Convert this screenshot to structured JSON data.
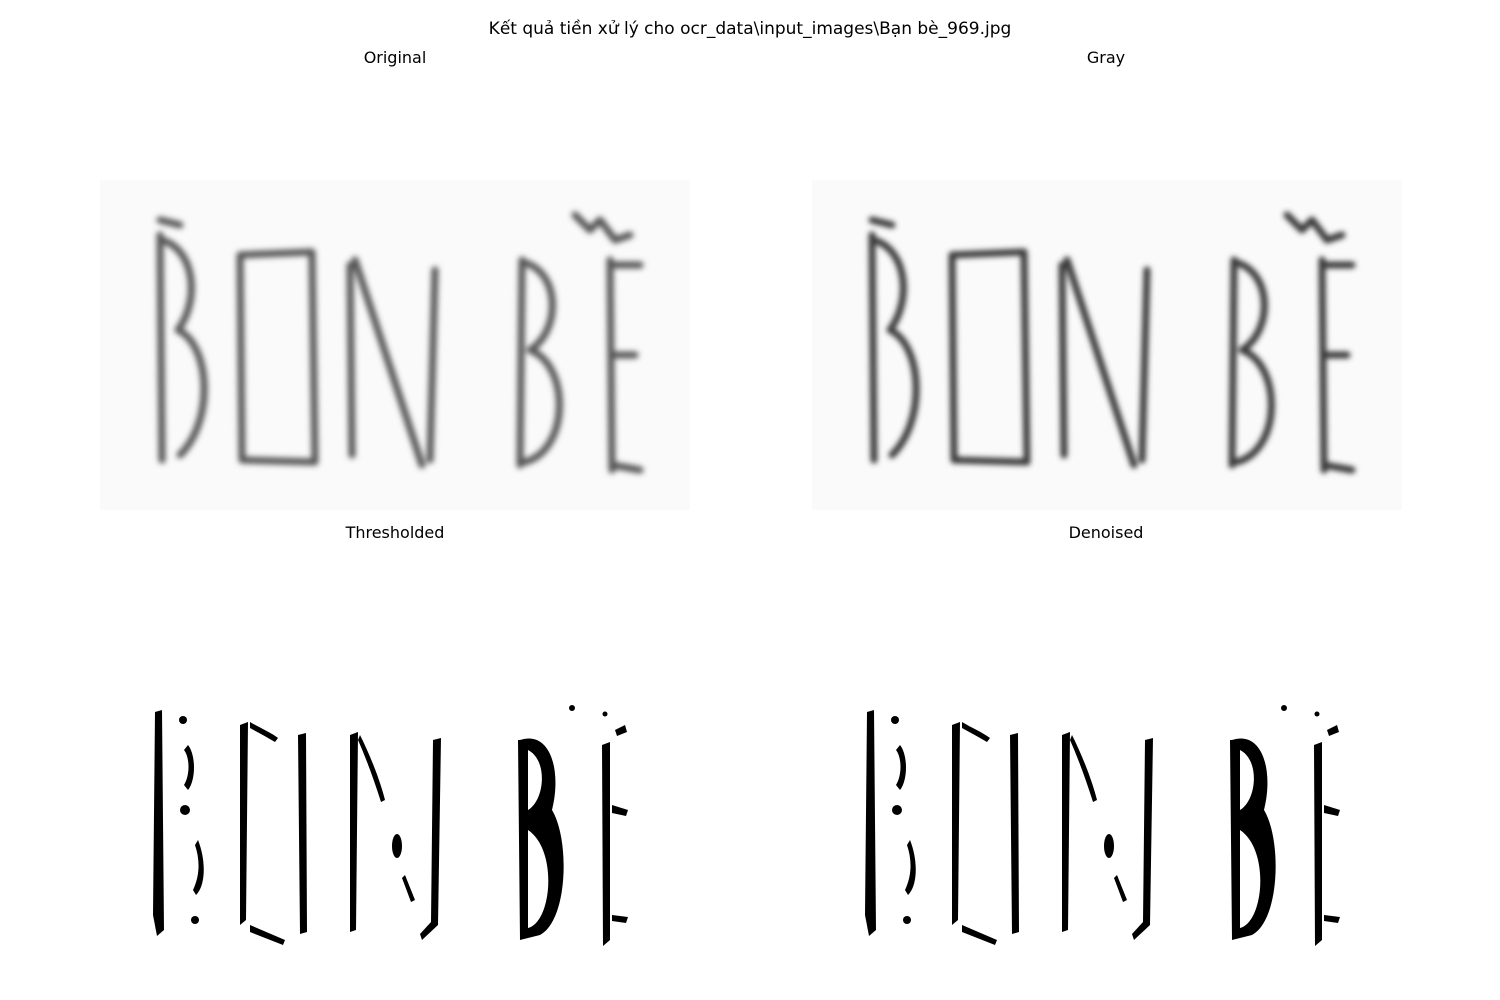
{
  "figure": {
    "suptitle": "Kết quả tiền xử lý cho ocr_data\\input_images\\Bạn bè_969.jpg"
  },
  "panels": [
    {
      "title": "Original",
      "image_text": "BON BE",
      "style": "blurred-gray"
    },
    {
      "title": "Gray",
      "image_text": "BON BE",
      "style": "blurred-darker-gray"
    },
    {
      "title": "Thresholded",
      "image_text": "BON BE",
      "style": "binary"
    },
    {
      "title": "Denoised",
      "image_text": "BON BE",
      "style": "binary"
    }
  ],
  "colors": {
    "background": "#ffffff",
    "ink_original": "#555555",
    "ink_gray": "#3a3a3a",
    "ink_binary": "#000000"
  }
}
